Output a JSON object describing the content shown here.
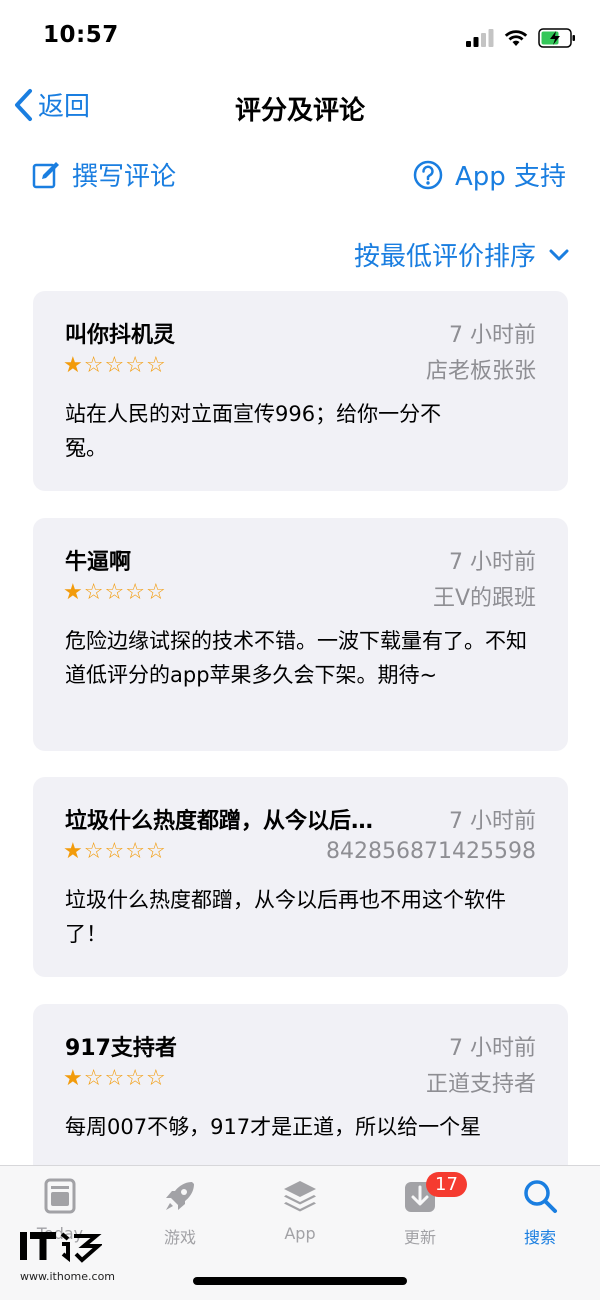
{
  "status_bar": {
    "time": "10:57"
  },
  "nav": {
    "back_label": "返回",
    "title": "评分及评论"
  },
  "actions": {
    "write_review": "撰写评论",
    "app_support": "App 支持"
  },
  "sort": {
    "label": "按最低评价排序"
  },
  "accent_color": "#1a7ee0",
  "star_color": "#f29b0b",
  "reviews": [
    {
      "title": "叫你抖机灵",
      "time": "7 小时前",
      "rating": 1,
      "max_rating": 5,
      "author": "店老板张张",
      "body": "站在人民的对立面宣传996；给你一分不冤。"
    },
    {
      "title": "牛逼啊",
      "time": "7 小时前",
      "rating": 1,
      "max_rating": 5,
      "author": "王V的跟班",
      "body": "危险边缘试探的技术不错。一波下载量有了。不知道低评分的app苹果多久会下架。期待~"
    },
    {
      "title": "垃圾什么热度都蹭，从今以后…",
      "time": "7 小时前",
      "rating": 1,
      "max_rating": 5,
      "author": "842856871425598",
      "body": "垃圾什么热度都蹭，从今以后再也不用这个软件了！"
    },
    {
      "title": "917支持者",
      "time": "7 小时前",
      "rating": 1,
      "max_rating": 5,
      "author": "正道支持者",
      "body": "每周007不够，917才是正道，所以给一个星"
    }
  ],
  "tabs": [
    {
      "label": "Today",
      "icon": "today-icon"
    },
    {
      "label": "游戏",
      "icon": "rocket-icon"
    },
    {
      "label": "App",
      "icon": "layers-icon"
    },
    {
      "label": "更新",
      "icon": "download-icon",
      "badge": "17"
    },
    {
      "label": "搜索",
      "icon": "search-icon",
      "active": true
    }
  ],
  "watermark": {
    "text": "www.ithome.com"
  }
}
